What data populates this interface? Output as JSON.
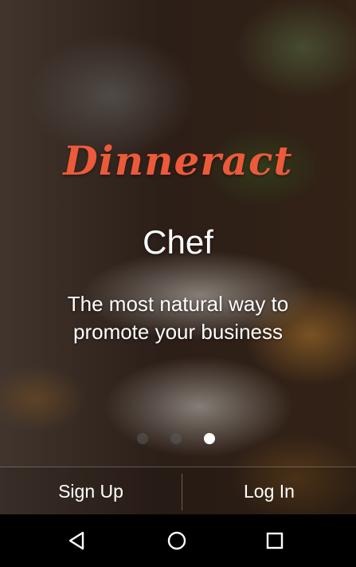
{
  "brand": {
    "logo_text": "Dinneract",
    "logo_color": "#ec5a3a"
  },
  "onboarding": {
    "subtitle": "Chef",
    "tagline": "The most natural way to promote your business",
    "page_indicator": {
      "total": 3,
      "active": 3
    }
  },
  "actions": {
    "sign_up": "Sign Up",
    "log_in": "Log In"
  },
  "system_nav": {
    "icons": [
      "back-icon",
      "home-icon",
      "recents-icon"
    ]
  }
}
